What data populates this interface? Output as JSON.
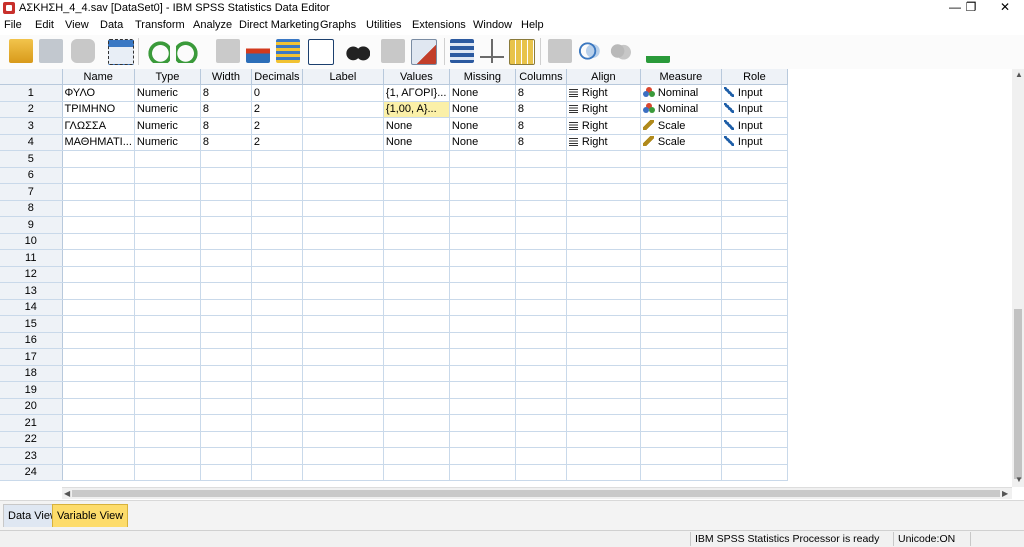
{
  "window": {
    "title": "ΑΣΚΗΣΗ_4_4.sav [DataSet0] - IBM SPSS Statistics Data Editor",
    "minimize": "—",
    "restore": "❐",
    "close": "✕"
  },
  "menu": [
    "File",
    "Edit",
    "View",
    "Data",
    "Transform",
    "Analyze",
    "Direct Marketing",
    "Graphs",
    "Utilities",
    "Extensions",
    "Window",
    "Help"
  ],
  "grid": {
    "columns": [
      "Name",
      "Type",
      "Width",
      "Decimals",
      "Label",
      "Values",
      "Missing",
      "Columns",
      "Align",
      "Measure",
      "Role"
    ],
    "rows": [
      {
        "num": "1",
        "name": "ΦΥΛΟ",
        "type": "Numeric",
        "width": "8",
        "decimals": "0",
        "label": "",
        "values": "{1, ΑΓΟΡΙ}...",
        "missing": "None",
        "columns": "8",
        "align": "Right",
        "measure": "Nominal",
        "role": "Input"
      },
      {
        "num": "2",
        "name": "ΤΡΙΜΗΝΟ",
        "type": "Numeric",
        "width": "8",
        "decimals": "2",
        "label": "",
        "values": "{1,00, Α}...",
        "missing": "None",
        "columns": "8",
        "align": "Right",
        "measure": "Nominal",
        "role": "Input"
      },
      {
        "num": "3",
        "name": "ΓΛΩΣΣΑ",
        "type": "Numeric",
        "width": "8",
        "decimals": "2",
        "label": "",
        "values": "None",
        "missing": "None",
        "columns": "8",
        "align": "Right",
        "measure": "Scale",
        "role": "Input"
      },
      {
        "num": "4",
        "name": "ΜΑΘΗΜΑΤΙ...",
        "type": "Numeric",
        "width": "8",
        "decimals": "2",
        "label": "",
        "values": "None",
        "missing": "None",
        "columns": "8",
        "align": "Right",
        "measure": "Scale",
        "role": "Input"
      }
    ],
    "empty_rows": [
      "5",
      "6",
      "7",
      "8",
      "9",
      "10",
      "11",
      "12",
      "13",
      "14",
      "15",
      "16",
      "17",
      "18",
      "19",
      "20",
      "21",
      "22",
      "23",
      "24"
    ]
  },
  "tabs": {
    "data_view": "Data View",
    "variable_view": "Variable View"
  },
  "status": {
    "processor": "IBM SPSS Statistics Processor is ready",
    "unicode": "Unicode:ON"
  },
  "colors": {
    "selected_cell": "#fbf0a8",
    "active_tab": "#fddc6b",
    "header_bg": "#eef2f7",
    "grid_line": "#c9d9ea"
  }
}
